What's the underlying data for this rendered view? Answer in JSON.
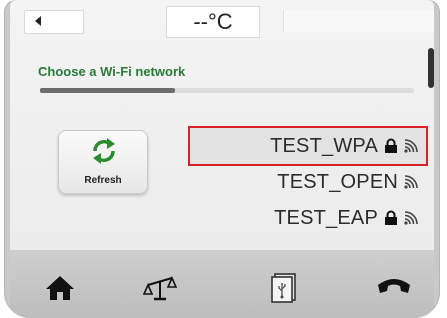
{
  "topbar": {
    "temperature": "--°C"
  },
  "wifi": {
    "title": "Choose a Wi-Fi network",
    "scan_progress": 0.36
  },
  "refresh": {
    "label": "Refresh",
    "icon": "refresh-icon"
  },
  "networks": [
    {
      "name": "TEST_WPA",
      "secured": true,
      "selected": true
    },
    {
      "name": "TEST_OPEN",
      "secured": false,
      "selected": false
    },
    {
      "name": "TEST_EAP",
      "secured": true,
      "selected": false
    }
  ],
  "bottom_nav": {
    "items": [
      "home-icon",
      "scale-icon",
      "usb-icon",
      "handset-icon"
    ]
  },
  "colors": {
    "title_green": "#2a7a3a",
    "selection_red": "#d8222a",
    "lock_green": "#111111"
  }
}
